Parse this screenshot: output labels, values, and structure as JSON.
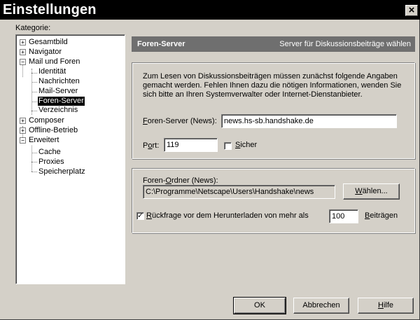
{
  "window": {
    "title": "Einstellungen",
    "close_glyph": "×"
  },
  "category_label": "Kategorie:",
  "tree": {
    "items": [
      {
        "label": "Gesamtbild",
        "expander": "+"
      },
      {
        "label": "Navigator",
        "expander": "+"
      },
      {
        "label": "Mail und Foren",
        "expander": "−"
      },
      {
        "label": "Identität"
      },
      {
        "label": "Nachrichten"
      },
      {
        "label": "Mail-Server"
      },
      {
        "label": "Foren-Server",
        "selected": true
      },
      {
        "label": "Verzeichnis"
      },
      {
        "label": "Composer",
        "expander": "+"
      },
      {
        "label": "Offline-Betrieb",
        "expander": "+"
      },
      {
        "label": "Erweitert",
        "expander": "−"
      },
      {
        "label": "Cache"
      },
      {
        "label": "Proxies"
      },
      {
        "label": "Speicherplatz"
      }
    ]
  },
  "header": {
    "title": "Foren-Server",
    "subtitle": "Server für Diskussionsbeiträge wählen"
  },
  "server_group": {
    "intro_line1": "Zum Lesen von Diskussionsbeiträgen müssen zunächst folgende Angaben",
    "intro_line2": "gemacht werden. Fehlen Ihnen dazu die nötigen Informationen, wenden Sie",
    "intro_line3": "sich bitte an Ihren Systemverwalter oder Internet-Dienstanbieter.",
    "server_label_mnemonic": "F",
    "server_label_rest": "oren-Server (News):",
    "server_value": "news.hs-sb.handshake.de",
    "port_label_pre": "P",
    "port_label_mnemonic": "o",
    "port_label_rest": "rt:",
    "port_value": "119",
    "secure_mnemonic": "S",
    "secure_rest": "icher",
    "secure_checked": false
  },
  "folder_group": {
    "label_pre": "Foren-",
    "label_mnemonic": "O",
    "label_rest": "rdner (News):",
    "path_value": "C:\\Programme\\Netscape\\Users\\Handshake\\news",
    "choose_mnemonic": "W",
    "choose_rest": "ählen...",
    "ask_checked": true,
    "ask_check_glyph": "✓",
    "ask_mnemonic": "R",
    "ask_rest": "ückfrage vor dem Herunterladen von mehr als",
    "ask_count": "100",
    "ask_suffix_mnemonic": "B",
    "ask_suffix_rest": "eiträgen"
  },
  "buttons": {
    "ok": "OK",
    "cancel": "Abbrechen",
    "help_mnemonic": "H",
    "help_rest": "ilfe"
  }
}
